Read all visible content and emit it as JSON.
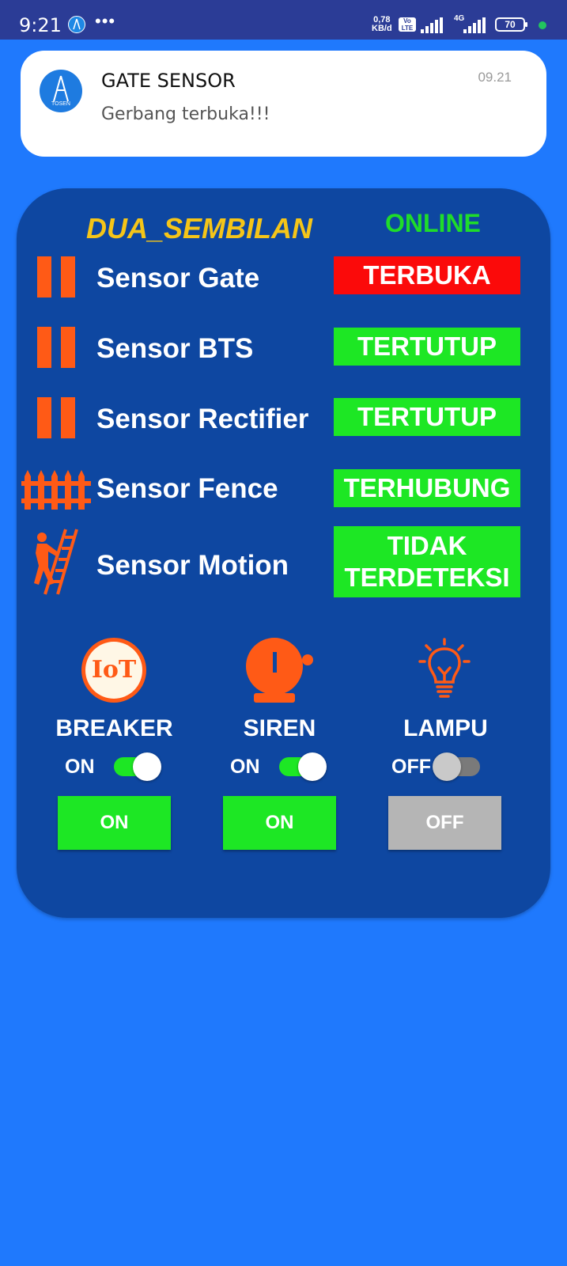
{
  "status_bar": {
    "time": "9:21",
    "more": "•••",
    "speed_value": "0,78",
    "speed_unit": "KB/d",
    "volte_top": "Vo",
    "volte_bottom": "LTE",
    "network": "4G",
    "battery": "70"
  },
  "notification": {
    "title": "GATE SENSOR",
    "body": "Gerbang terbuka!!!",
    "time": "09.21",
    "logo_text": "TOSEN"
  },
  "panel": {
    "device_name": "DUA_SEMBILAN",
    "connection_status": "ONLINE",
    "sensors": [
      {
        "label": "Sensor Gate",
        "status": "TERBUKA",
        "status_color": "#fb0a0a"
      },
      {
        "label": "Sensor BTS",
        "status": "TERTUTUP",
        "status_color": "#1de724"
      },
      {
        "label": "Sensor Rectifier",
        "status": "TERTUTUP",
        "status_color": "#1de724"
      },
      {
        "label": "Sensor Fence",
        "status": "TERHUBUNG",
        "status_color": "#1de724"
      },
      {
        "label": "Sensor Motion",
        "status_line1": "TIDAK",
        "status_line2": "TERDETEKSI",
        "status_color": "#1de724"
      }
    ],
    "controls": [
      {
        "label": "BREAKER",
        "icon_text": "IoT",
        "switch_text": "ON",
        "switch_on": true,
        "button": "ON"
      },
      {
        "label": "SIREN",
        "switch_text": "ON",
        "switch_on": true,
        "button": "ON"
      },
      {
        "label": "LAMPU",
        "switch_text": "OFF",
        "switch_on": false,
        "button": "OFF"
      }
    ]
  },
  "colors": {
    "background": "#1f79fd",
    "panel": "#0e47a1",
    "accent_orange": "#ff5a16",
    "title_yellow": "#f5c518",
    "online_green": "#1fdc2a",
    "button_on": "#1de724",
    "button_off": "#b5b5b5"
  }
}
